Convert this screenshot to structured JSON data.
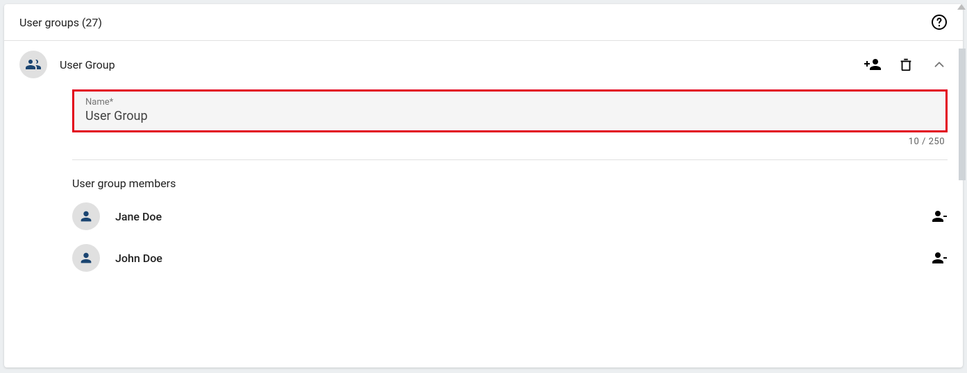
{
  "header": {
    "title": "User groups (27)"
  },
  "group": {
    "title": "User Group",
    "name_label": "Name*",
    "name_value": "User Group",
    "char_counter": "10 / 250"
  },
  "members": {
    "heading": "User group members",
    "items": [
      {
        "name": "Jane Doe"
      },
      {
        "name": "John Doe"
      }
    ]
  }
}
